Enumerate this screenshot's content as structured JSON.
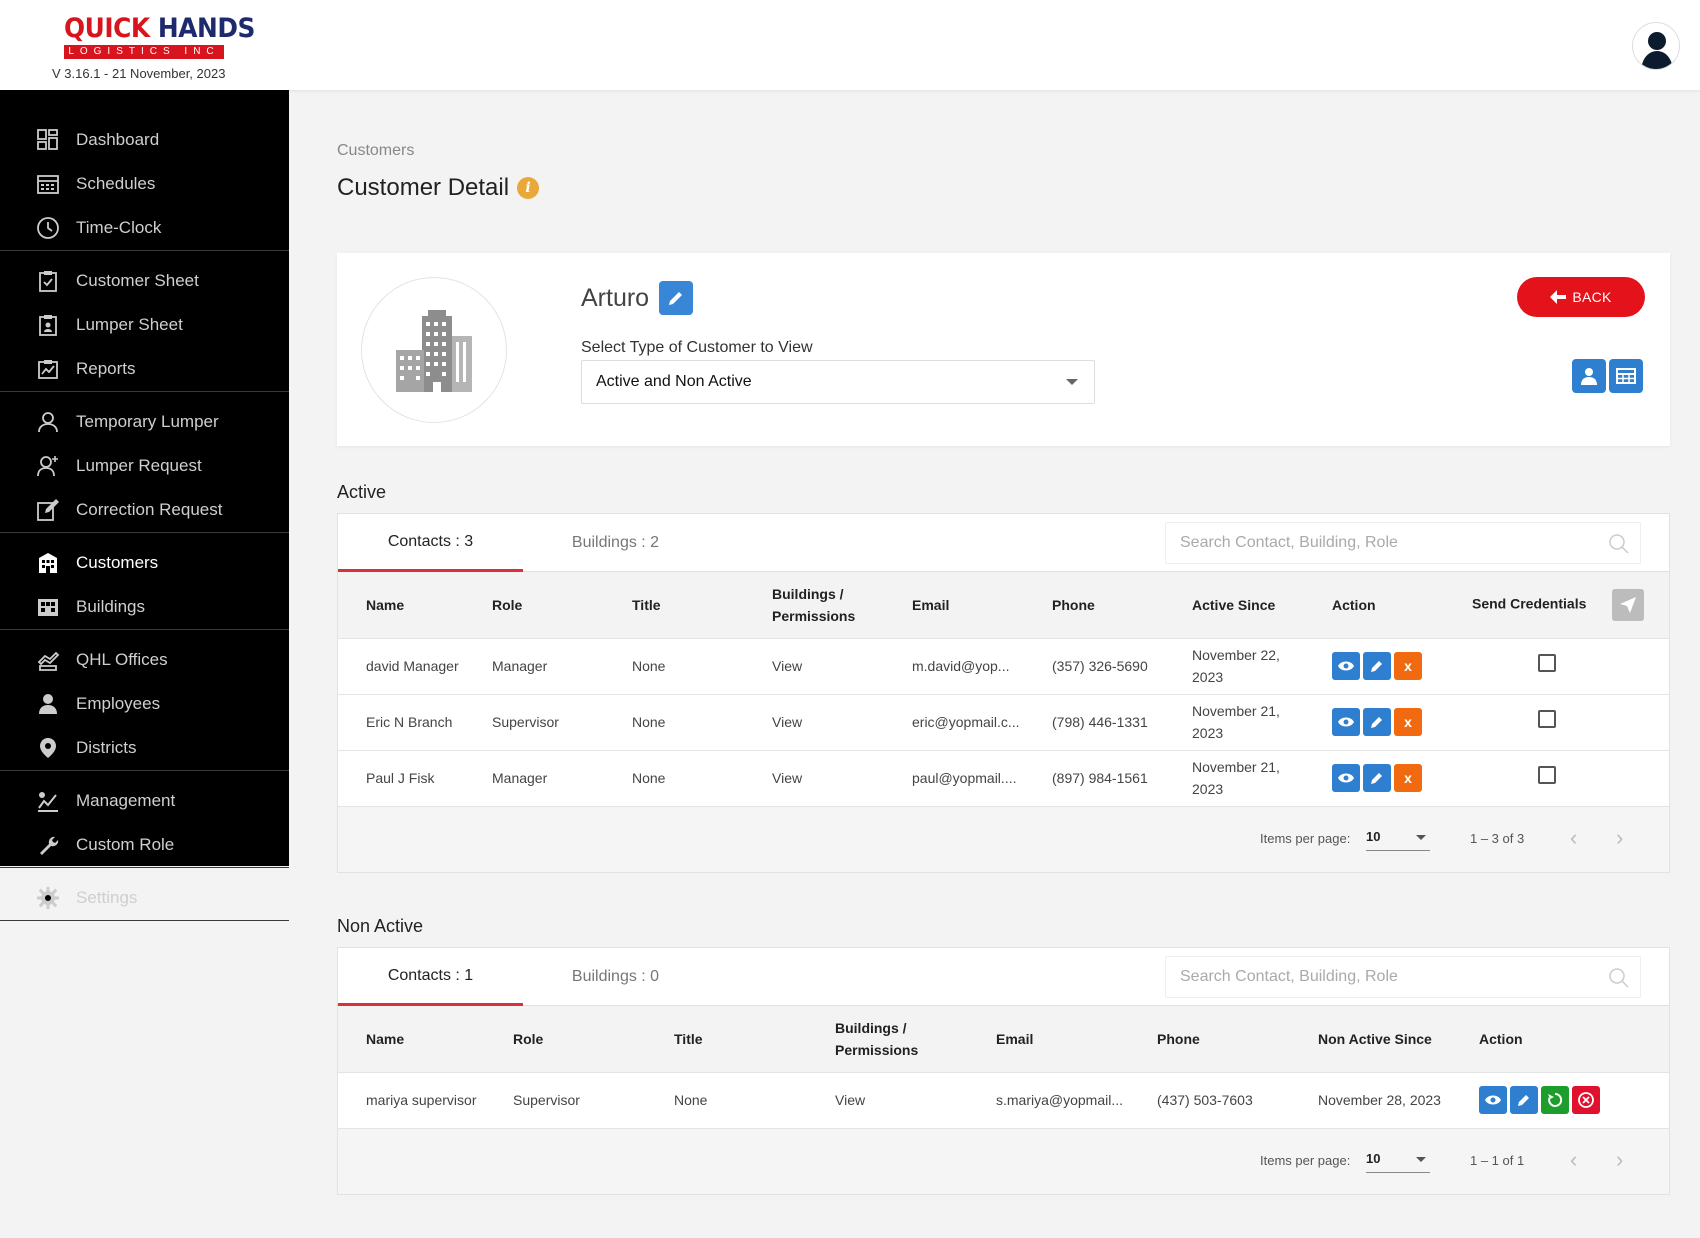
{
  "brand": {
    "logo_word1": "QUICK",
    "logo_word2": "HANDS",
    "logo_sub": "LOGISTICS INC",
    "version": "V 3.16.1 - 21 November, 2023"
  },
  "sidebar": {
    "groups": [
      [
        {
          "label": "Dashboard",
          "icon": "dashboard-icon"
        },
        {
          "label": "Schedules",
          "icon": "calendar-icon"
        },
        {
          "label": "Time-Clock",
          "icon": "clock-icon"
        }
      ],
      [
        {
          "label": "Customer Sheet",
          "icon": "clipboard-check-icon"
        },
        {
          "label": "Lumper Sheet",
          "icon": "clipboard-person-icon"
        },
        {
          "label": "Reports",
          "icon": "chart-report-icon"
        }
      ],
      [
        {
          "label": "Temporary Lumper",
          "icon": "person-outline-icon"
        },
        {
          "label": "Lumper Request",
          "icon": "person-add-icon"
        },
        {
          "label": "Correction Request",
          "icon": "edit-note-icon"
        }
      ],
      [
        {
          "label": "Customers",
          "icon": "building-icon",
          "active": true
        },
        {
          "label": "Buildings",
          "icon": "grid-building-icon"
        }
      ],
      [
        {
          "label": "QHL Offices",
          "icon": "office-hand-icon"
        },
        {
          "label": "Employees",
          "icon": "person-icon"
        },
        {
          "label": "Districts",
          "icon": "map-pin-icon"
        }
      ],
      [
        {
          "label": "Management",
          "icon": "management-icon"
        },
        {
          "label": "Custom Role",
          "icon": "wrench-icon"
        }
      ],
      [
        {
          "label": "Settings",
          "icon": "gear-icon"
        }
      ]
    ]
  },
  "page": {
    "breadcrumb": "Customers",
    "title": "Customer Detail"
  },
  "customer": {
    "name": "Arturo",
    "select_label": "Select Type of Customer to View",
    "select_value": "Active and Non Active",
    "back_label": "BACK"
  },
  "active": {
    "section_title": "Active",
    "tabs": [
      "Contacts : 3",
      "Buildings : 2"
    ],
    "search_placeholder": "Search Contact, Building, Role",
    "columns": [
      "Name",
      "Role",
      "Title",
      "Buildings / Permissions",
      "Email",
      "Phone",
      "Active Since",
      "Action",
      "Send Credentials"
    ],
    "rows": [
      {
        "name": "david Manager",
        "role": "Manager",
        "title": "None",
        "perm": "View",
        "email": "m.david@yop...",
        "phone": "(357) 326-5690",
        "since": "November 22, 2023"
      },
      {
        "name": "Eric N Branch",
        "role": "Supervisor",
        "title": "None",
        "perm": "View",
        "email": "eric@yopmail.c...",
        "phone": "(798) 446-1331",
        "since": "November 21, 2023"
      },
      {
        "name": "Paul J Fisk",
        "role": "Manager",
        "title": "None",
        "perm": "View",
        "email": "paul@yopmail....",
        "phone": "(897) 984-1561",
        "since": "November 21, 2023"
      }
    ],
    "pager": {
      "ipp_label": "Items per page:",
      "ipp_value": "10",
      "range": "1 – 3 of 3"
    }
  },
  "nonactive": {
    "section_title": "Non Active",
    "tabs": [
      "Contacts : 1",
      "Buildings : 0"
    ],
    "search_placeholder": "Search Contact, Building, Role",
    "columns": [
      "Name",
      "Role",
      "Title",
      "Buildings / Permissions",
      "Email",
      "Phone",
      "Non Active Since",
      "Action"
    ],
    "rows": [
      {
        "name": "mariya supervisor",
        "role": "Supervisor",
        "title": "None",
        "perm": "View",
        "email": "s.mariya@yopmail...",
        "phone": "(437) 503-7603",
        "since": "November 28, 2023"
      }
    ],
    "pager": {
      "ipp_label": "Items per page:",
      "ipp_value": "10",
      "range": "1 – 1 of 1"
    }
  },
  "colors": {
    "brand_red": "#d8141f",
    "brand_navy": "#1e2a6e",
    "action_blue": "#2f7fd1",
    "delete_orange": "#f26a0f",
    "restore_green": "#1c9d2c",
    "tab_underline": "#d9303a"
  }
}
